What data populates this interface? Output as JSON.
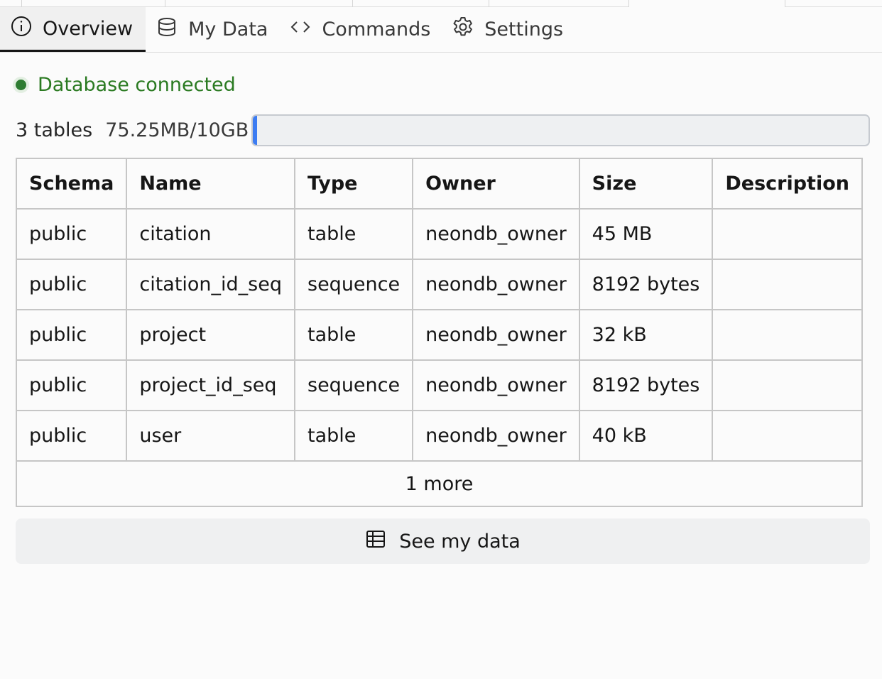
{
  "tabs": [
    {
      "label": "Overview",
      "icon": "info-icon",
      "active": true
    },
    {
      "label": "My Data",
      "icon": "database-icon",
      "active": false
    },
    {
      "label": "Commands",
      "icon": "code-icon",
      "active": false
    },
    {
      "label": "Settings",
      "icon": "gear-icon",
      "active": false
    }
  ],
  "status": {
    "text": "Database connected",
    "color": "#2e7d32"
  },
  "usage": {
    "tables": "3 tables",
    "size": "75.25MB/10GB",
    "fraction_used": 0.0073
  },
  "table": {
    "headers": [
      "Schema",
      "Name",
      "Type",
      "Owner",
      "Size",
      "Description"
    ],
    "rows": [
      [
        "public",
        "citation",
        "table",
        "neondb_owner",
        "45 MB",
        ""
      ],
      [
        "public",
        "citation_id_seq",
        "sequence",
        "neondb_owner",
        "8192 bytes",
        ""
      ],
      [
        "public",
        "project",
        "table",
        "neondb_owner",
        "32 kB",
        ""
      ],
      [
        "public",
        "project_id_seq",
        "sequence",
        "neondb_owner",
        "8192 bytes",
        ""
      ],
      [
        "public",
        "user",
        "table",
        "neondb_owner",
        "40 kB",
        ""
      ]
    ],
    "more": "1 more"
  },
  "see_data_button": {
    "label": "See my data",
    "icon": "table-icon"
  },
  "colors": {
    "accent": "#3c7cf2",
    "status_green": "#2a7a21"
  }
}
